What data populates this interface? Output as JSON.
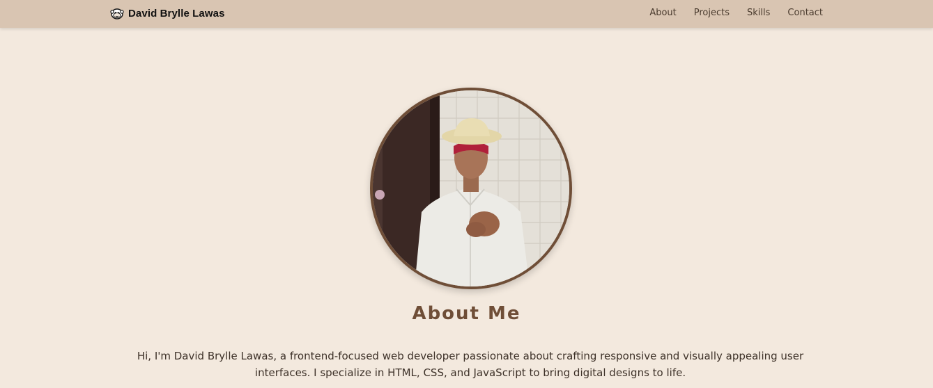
{
  "navbar": {
    "brand_icon": "monkey-face-icon",
    "brand_name": "David Brylle Lawas",
    "links": [
      {
        "label": "About"
      },
      {
        "label": "Projects"
      },
      {
        "label": "Skills"
      },
      {
        "label": "Contact"
      }
    ]
  },
  "about": {
    "photo_alt": "David Brylle Lawas",
    "title": "About Me",
    "text": "Hi, I'm David Brylle Lawas, a frontend-focused web developer passionate about crafting responsive and visually appealing user interfaces. I specialize in HTML, CSS, and JavaScript to bring digital designs to life."
  },
  "colors": {
    "navbar_bg": "#d9c5b2",
    "page_bg": "#f3e9de",
    "accent": "#6f4e37"
  }
}
